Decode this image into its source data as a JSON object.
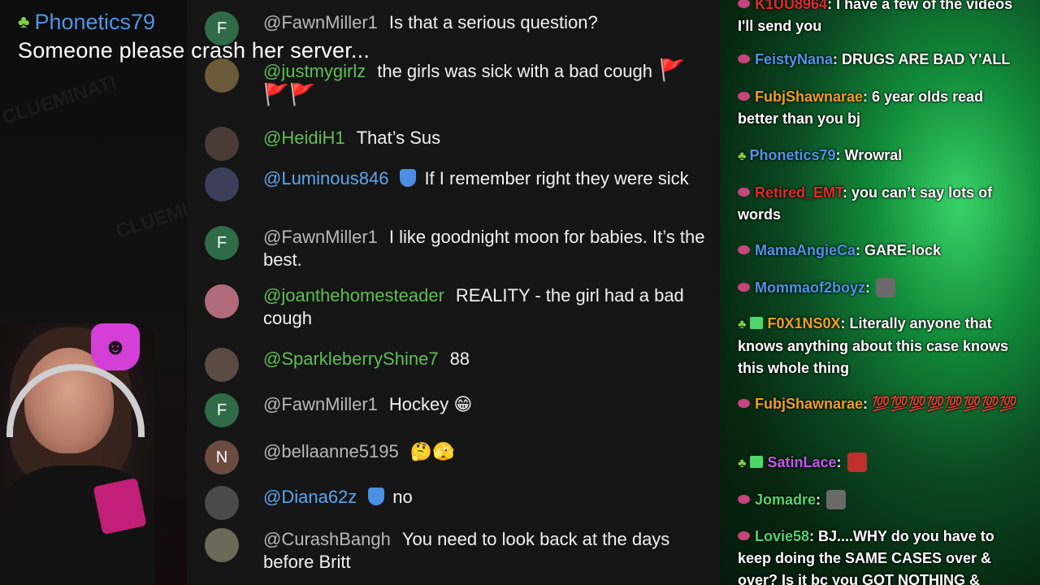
{
  "watermark": "CLUEMINATI",
  "alert": {
    "username": "Phonetics79",
    "message": "Someone please crash her server..."
  },
  "comments": [
    {
      "avatar": "F",
      "avatar_color": "#2e6b46",
      "username": "@FawnMiller1",
      "name_color": "grey",
      "text": "Is that a serious question?"
    },
    {
      "avatar": "",
      "avatar_color": "#6b5a3a",
      "username": "@justmygirlz",
      "name_color": "green",
      "text": "the girls was sick with a bad cough",
      "trail": "🚩🚩🚩"
    },
    {
      "avatar": "",
      "avatar_color": "#4a3a36",
      "username": "@HeidiH1",
      "name_color": "green",
      "text": "That’s Sus"
    },
    {
      "avatar": "",
      "avatar_color": "#3b3f5a",
      "username": "@Luminous846",
      "name_color": "blue",
      "text": "If I remember right they were sick"
    },
    {
      "avatar": "F",
      "avatar_color": "#2e6b46",
      "username": "@FawnMiller1",
      "name_color": "grey",
      "text": "I like goodnight moon for babies. It’s the best."
    },
    {
      "avatar": "",
      "avatar_color": "#b06a7a",
      "username": "@joanthehomesteader",
      "name_color": "green",
      "text": "REALITY - the girl had a bad cough"
    },
    {
      "avatar": "",
      "avatar_color": "#5a4a42",
      "username": "@SparkleberryShine7",
      "name_color": "green",
      "text": "88"
    },
    {
      "avatar": "F",
      "avatar_color": "#2e6b46",
      "username": "@FawnMiller1",
      "name_color": "grey",
      "text": "Hockey 😁"
    },
    {
      "avatar": "N",
      "avatar_color": "#6b4b40",
      "username": "@bellaanne5195",
      "name_color": "grey",
      "text": "🤔🫣"
    },
    {
      "avatar": "",
      "avatar_color": "#4a4a4a",
      "username": "@Diana62z",
      "name_color": "blue",
      "text": "no"
    },
    {
      "avatar": "",
      "avatar_color": "#6a6a58",
      "username": "@CurashBangh",
      "name_color": "grey",
      "text": "You need to look back at the days before Britt"
    }
  ],
  "chat": [
    {
      "username": "K1UU8964",
      "user_color": "#e02b2b",
      "icon": "chip",
      "text": "I have a few of the videos I'll send you"
    },
    {
      "username": "FeistyNana",
      "user_color": "#4f95e6",
      "icon": "chip",
      "text": "DRUGS ARE BAD Y'ALL"
    },
    {
      "username": "FubjShawnarae",
      "user_color": "#f0a020",
      "icon": "chip",
      "text": "6 year olds read better than you bj"
    },
    {
      "username": "Phonetics79",
      "user_color": "#4f95e6",
      "icon": "sprout",
      "text": "Wrowral"
    },
    {
      "username": "Retired_EMT",
      "user_color": "#e02b2b",
      "icon": "chip",
      "text": "you can’t say lots of words"
    },
    {
      "username": "MamaAngieCa",
      "user_color": "#4f95e6",
      "icon": "chip",
      "text": "GARE-lock"
    },
    {
      "username": "Mommaof2boyz",
      "user_color": "#4f95e6",
      "icon": "chip",
      "text": ""
    },
    {
      "username": "F0X1NS0X",
      "user_color": "#f0a020",
      "icon": "sprout-gift",
      "text": "Literally anyone that knows anything about this case knows this whole thing"
    },
    {
      "username": "FubjShawnarae",
      "user_color": "#f0a020",
      "icon": "chip",
      "text": "💯💯💯💯💯💯💯💯"
    },
    {
      "username": "SatinLace",
      "user_color": "#c15ae8",
      "icon": "sprout-gift",
      "text": ""
    },
    {
      "username": "Jomadre",
      "user_color": "#4fd66a",
      "icon": "chip",
      "text": ""
    },
    {
      "username": "Lovie58",
      "user_color": "#4fd66a",
      "icon": "chip",
      "text": "BJ....WHY do you have to keep doing the SAME CASES over & over? Is it bc you GOT NOTHING &"
    }
  ]
}
